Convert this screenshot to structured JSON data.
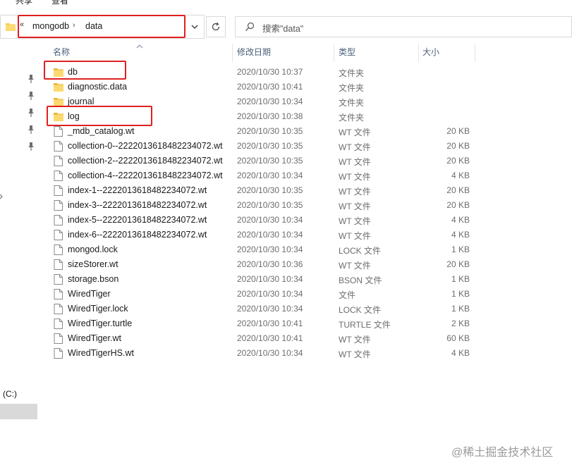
{
  "ribbon": {
    "tabs": [
      "共享",
      "查看"
    ]
  },
  "address": {
    "overflow_glyph": "«",
    "segments": [
      "mongodb",
      "data"
    ],
    "separator": "›"
  },
  "search": {
    "placeholder": "搜索\"data\""
  },
  "columns": {
    "name": "名称",
    "date": "修改日期",
    "type": "类型",
    "size": "大小"
  },
  "nav": {
    "drive_label": "(C:)"
  },
  "files": [
    {
      "name": "db",
      "date": "2020/10/30 10:37",
      "type": "文件夹",
      "size": "",
      "kind": "folder"
    },
    {
      "name": "diagnostic.data",
      "date": "2020/10/30 10:41",
      "type": "文件夹",
      "size": "",
      "kind": "folder"
    },
    {
      "name": "journal",
      "date": "2020/10/30 10:34",
      "type": "文件夹",
      "size": "",
      "kind": "folder"
    },
    {
      "name": "log",
      "date": "2020/10/30 10:38",
      "type": "文件夹",
      "size": "",
      "kind": "folder"
    },
    {
      "name": "_mdb_catalog.wt",
      "date": "2020/10/30 10:35",
      "type": "WT 文件",
      "size": "20 KB",
      "kind": "file"
    },
    {
      "name": "collection-0--2222013618482234072.wt",
      "date": "2020/10/30 10:35",
      "type": "WT 文件",
      "size": "20 KB",
      "kind": "file"
    },
    {
      "name": "collection-2--2222013618482234072.wt",
      "date": "2020/10/30 10:35",
      "type": "WT 文件",
      "size": "20 KB",
      "kind": "file"
    },
    {
      "name": "collection-4--2222013618482234072.wt",
      "date": "2020/10/30 10:34",
      "type": "WT 文件",
      "size": "4 KB",
      "kind": "file"
    },
    {
      "name": "index-1--2222013618482234072.wt",
      "date": "2020/10/30 10:35",
      "type": "WT 文件",
      "size": "20 KB",
      "kind": "file"
    },
    {
      "name": "index-3--2222013618482234072.wt",
      "date": "2020/10/30 10:35",
      "type": "WT 文件",
      "size": "20 KB",
      "kind": "file"
    },
    {
      "name": "index-5--2222013618482234072.wt",
      "date": "2020/10/30 10:34",
      "type": "WT 文件",
      "size": "4 KB",
      "kind": "file"
    },
    {
      "name": "index-6--2222013618482234072.wt",
      "date": "2020/10/30 10:34",
      "type": "WT 文件",
      "size": "4 KB",
      "kind": "file"
    },
    {
      "name": "mongod.lock",
      "date": "2020/10/30 10:34",
      "type": "LOCK 文件",
      "size": "1 KB",
      "kind": "file"
    },
    {
      "name": "sizeStorer.wt",
      "date": "2020/10/30 10:36",
      "type": "WT 文件",
      "size": "20 KB",
      "kind": "file"
    },
    {
      "name": "storage.bson",
      "date": "2020/10/30 10:34",
      "type": "BSON 文件",
      "size": "1 KB",
      "kind": "file"
    },
    {
      "name": "WiredTiger",
      "date": "2020/10/30 10:34",
      "type": "文件",
      "size": "1 KB",
      "kind": "file"
    },
    {
      "name": "WiredTiger.lock",
      "date": "2020/10/30 10:34",
      "type": "LOCK 文件",
      "size": "1 KB",
      "kind": "file"
    },
    {
      "name": "WiredTiger.turtle",
      "date": "2020/10/30 10:41",
      "type": "TURTLE 文件",
      "size": "2 KB",
      "kind": "file"
    },
    {
      "name": "WiredTiger.wt",
      "date": "2020/10/30 10:41",
      "type": "WT 文件",
      "size": "60 KB",
      "kind": "file"
    },
    {
      "name": "WiredTigerHS.wt",
      "date": "2020/10/30 10:34",
      "type": "WT 文件",
      "size": "4 KB",
      "kind": "file"
    }
  ],
  "watermark": {
    "text": "@稀土掘金技术社区"
  },
  "colors": {
    "highlight_red": "#e02020",
    "folder_yellow": "#f7c94b",
    "header_text": "#4c607a",
    "meta_text": "#6d6d6d"
  }
}
